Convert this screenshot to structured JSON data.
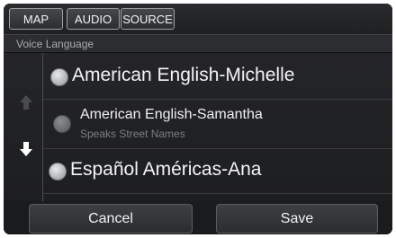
{
  "tabs": [
    {
      "label": "MAP"
    },
    {
      "label": "AUDIO"
    },
    {
      "label": "SOURCE"
    }
  ],
  "title": "Voice Language",
  "options": [
    {
      "label": "American English-Michelle",
      "selected": false
    },
    {
      "label": "American English-Samantha",
      "sublabel": "Speaks Street Names",
      "selected": false
    },
    {
      "label": "Español Américas-Ana",
      "selected": false
    }
  ],
  "scroll": {
    "up_icon": "arrow-up-icon",
    "down_icon": "arrow-down-icon"
  },
  "buttons": {
    "cancel": "Cancel",
    "save": "Save"
  }
}
